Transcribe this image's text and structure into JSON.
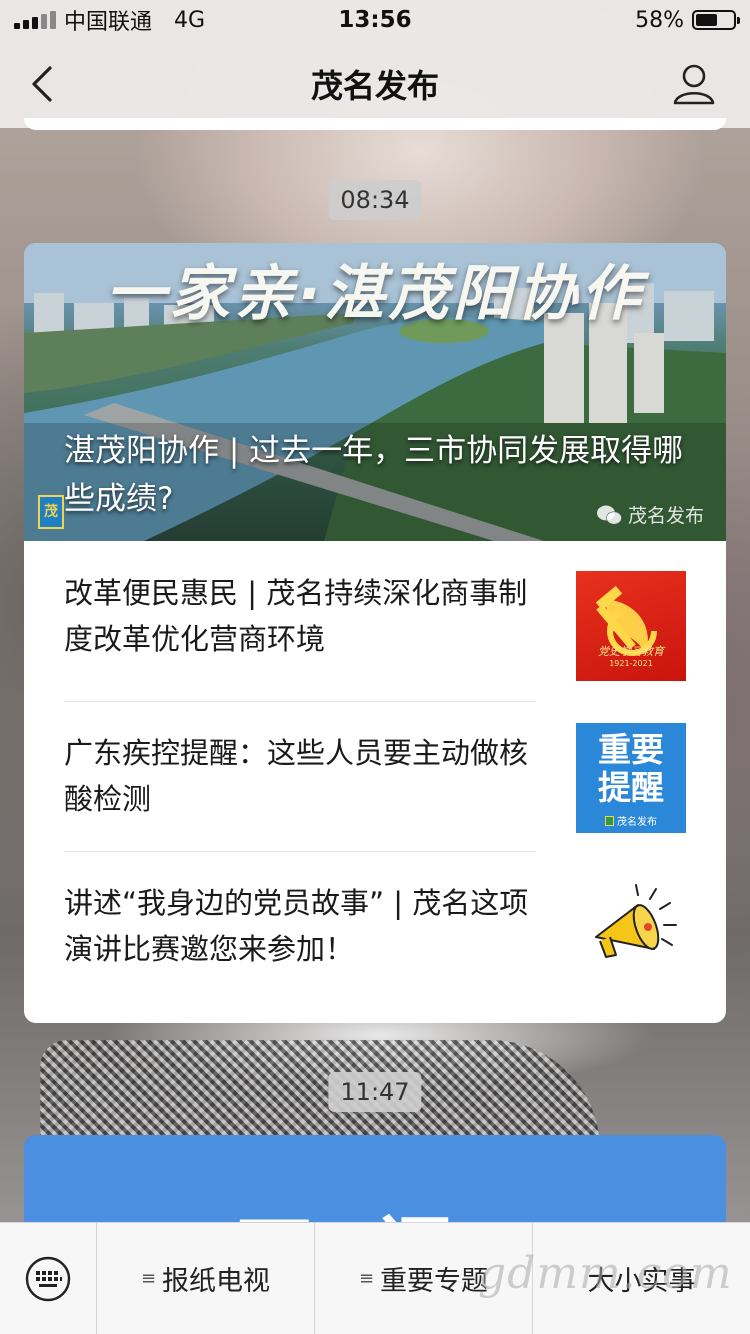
{
  "status_bar": {
    "carrier": "中国联通",
    "network": "4G",
    "time": "13:56",
    "battery_percent": "58%",
    "battery_level": 0.58
  },
  "nav": {
    "title": "茂名发布",
    "back_icon": "chevron-left-icon",
    "profile_icon": "user-icon"
  },
  "messages": [
    {
      "timestamp": "08:34",
      "hero": {
        "banner": "一家亲·湛茂阳协作",
        "title": "湛茂阳协作 | 过去一年，三市协同发展取得哪些成绩?",
        "logo_text": "茂",
        "source": "茂名发布"
      },
      "items": [
        {
          "title": "改革便民惠民 | 茂名持续深化商事制度改革优化营商环境",
          "thumb_caption": "党史学习教育",
          "thumb_years": "1921-2021"
        },
        {
          "title": "广东疾控提醒：这些人员要主动做核酸检测",
          "thumb_line1": "重要",
          "thumb_line2": "提醒",
          "thumb_source": "茂名发布"
        },
        {
          "title": "讲述“我身边的党员故事” | 茂名这项演讲比赛邀您来参加！"
        }
      ]
    },
    {
      "timestamp": "11:47",
      "peek_text": "开门"
    }
  ],
  "menu": {
    "items": [
      "报纸电视",
      "重要专题",
      "大小实事"
    ],
    "keyboard_icon": "keyboard-icon"
  },
  "watermark": "gdmm.com"
}
